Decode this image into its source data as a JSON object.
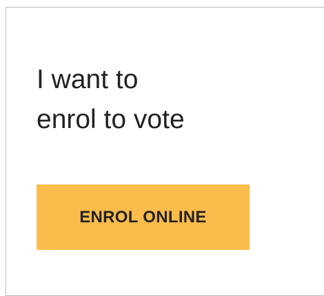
{
  "card": {
    "heading_line1": "I want to",
    "heading_line2": "enrol to vote",
    "button_label": "ENROL ONLINE",
    "button_color": "#fcbc4b",
    "text_color": "#222222"
  }
}
